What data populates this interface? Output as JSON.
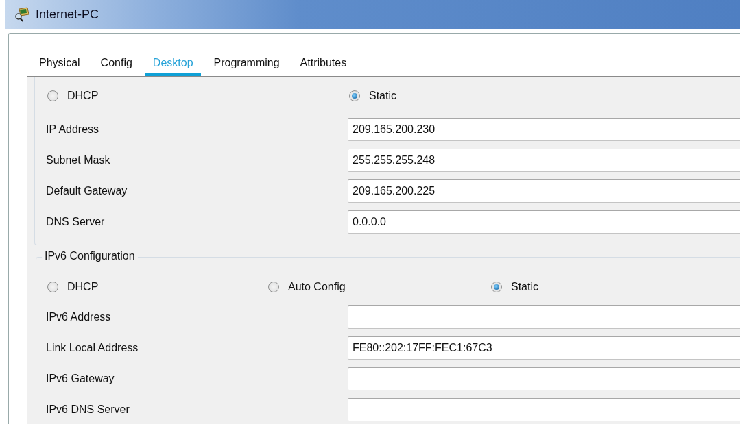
{
  "window": {
    "title": "Internet-PC"
  },
  "tabs": [
    {
      "label": "Physical",
      "selected": false
    },
    {
      "label": "Config",
      "selected": false
    },
    {
      "label": "Desktop",
      "selected": true
    },
    {
      "label": "Programming",
      "selected": false
    },
    {
      "label": "Attributes",
      "selected": false
    }
  ],
  "ipv4": {
    "modes": [
      {
        "label": "DHCP",
        "selected": false
      },
      {
        "label": "Static",
        "selected": true
      }
    ],
    "fields": [
      {
        "label": "IP Address",
        "value": "209.165.200.230"
      },
      {
        "label": "Subnet Mask",
        "value": "255.255.255.248"
      },
      {
        "label": "Default Gateway",
        "value": "209.165.200.225"
      },
      {
        "label": "DNS Server",
        "value": "0.0.0.0"
      }
    ]
  },
  "ipv6": {
    "title": "IPv6 Configuration",
    "modes": [
      {
        "label": "DHCP",
        "selected": false
      },
      {
        "label": "Auto Config",
        "selected": false
      },
      {
        "label": "Static",
        "selected": true
      }
    ],
    "fields": [
      {
        "label": "IPv6 Address"
      },
      {
        "label": "Link Local Address",
        "value": "FE80::202:17FF:FEC1:67C3"
      },
      {
        "label": "IPv6 Gateway"
      },
      {
        "label": "IPv6 DNS Server"
      }
    ]
  }
}
